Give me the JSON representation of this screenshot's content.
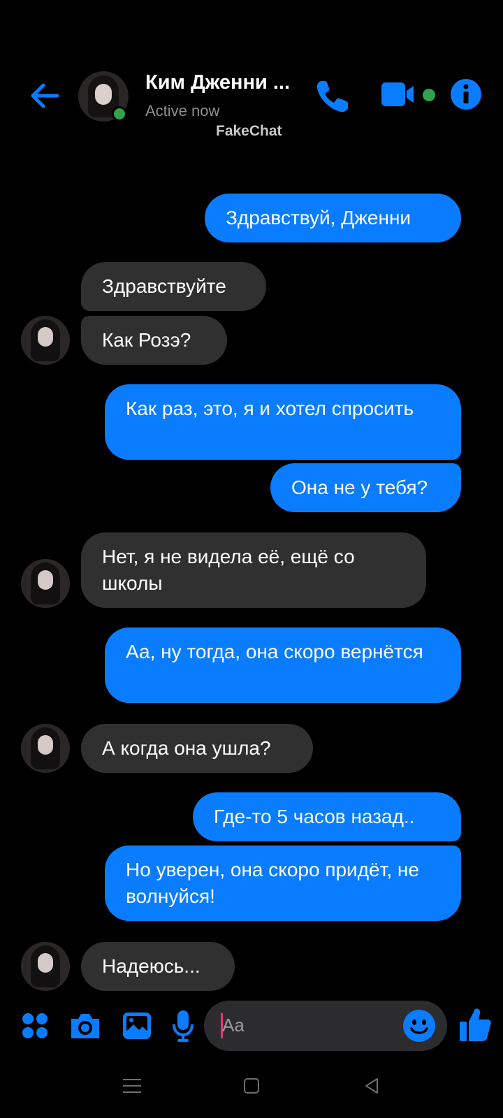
{
  "header": {
    "contact_name": "Ким Дженни ...",
    "status": "Active now",
    "watermark": "FakeChat"
  },
  "icons": {
    "back": "arrow-left-icon",
    "phone": "phone-icon",
    "video": "video-camera-icon",
    "info": "info-icon",
    "apps": "apps-grid-icon",
    "camera": "camera-icon",
    "gallery": "image-icon",
    "mic": "microphone-icon",
    "emoji": "emoji-icon",
    "like": "thumbs-up-icon"
  },
  "colors": {
    "accent": "#0a7cff",
    "incoming_bubble": "#303030",
    "online": "#31a24c",
    "background": "#000000"
  },
  "messages": [
    {
      "from": "me",
      "text": "Здравствуй, Дженни"
    },
    {
      "from": "them",
      "text": "Здравствуйте"
    },
    {
      "from": "them",
      "text": "Как Розэ?"
    },
    {
      "from": "me",
      "text": "Как раз, это, я и хотел спросить"
    },
    {
      "from": "me",
      "text": "Она не у тебя?"
    },
    {
      "from": "them",
      "text": "Нет, я не видела её, ещё со школы"
    },
    {
      "from": "me",
      "text": "Аа, ну тогда, она скоро вернётся"
    },
    {
      "from": "them",
      "text": "А когда она ушла?"
    },
    {
      "from": "me",
      "text": "Где-то 5 часов назад.."
    },
    {
      "from": "me",
      "text": "Но уверен, она скоро придёт, не волнуйся!"
    },
    {
      "from": "them",
      "text": "Надеюсь..."
    }
  ],
  "composer": {
    "placeholder": "Aa"
  }
}
